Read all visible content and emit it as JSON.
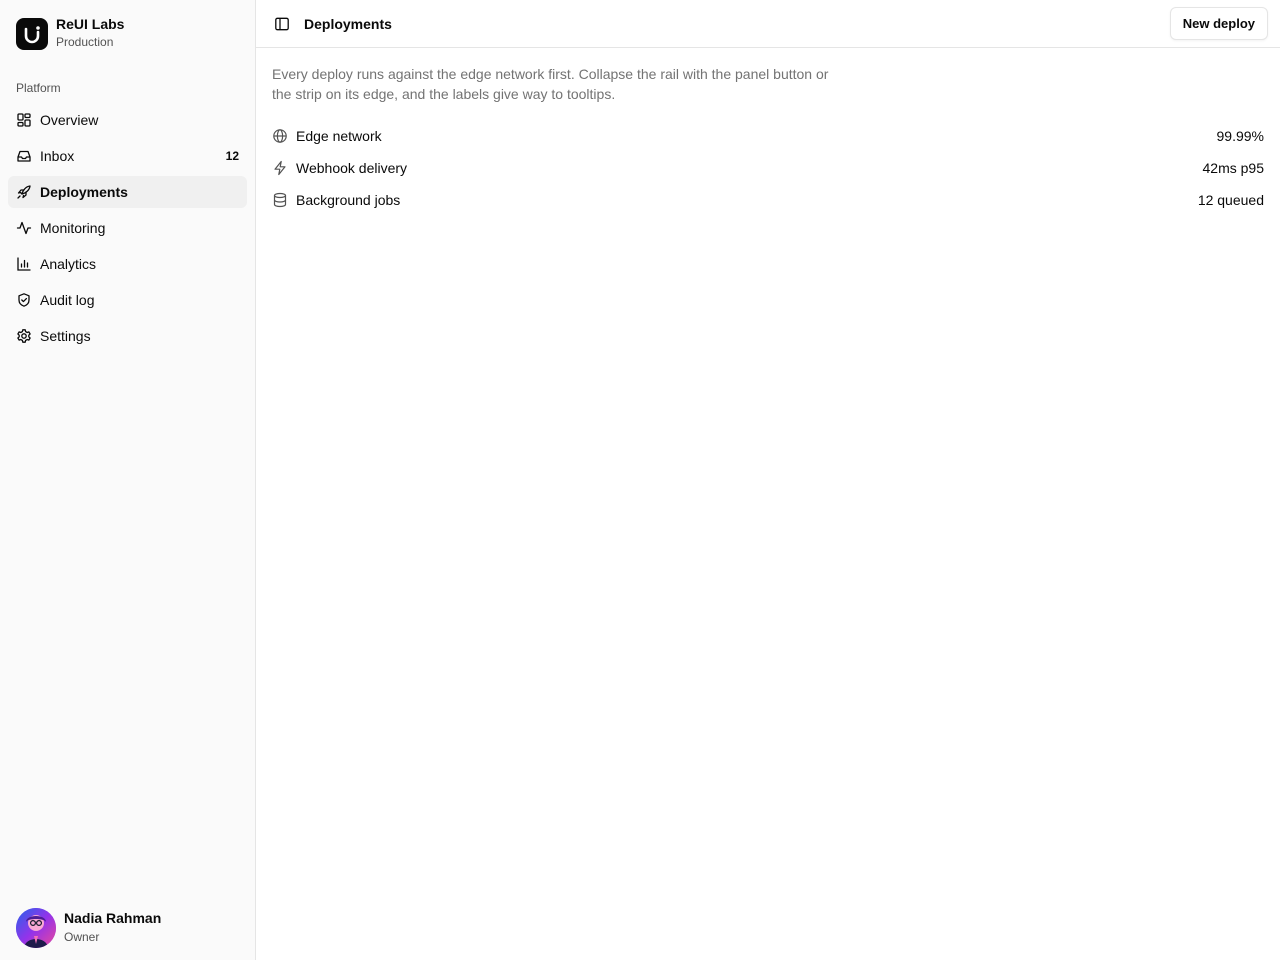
{
  "team": {
    "name": "ReUI Labs",
    "environment": "Production",
    "logo_icon": "reui-logo-icon"
  },
  "sidebar": {
    "group_label": "Platform",
    "items": [
      {
        "label": "Overview",
        "icon": "layout-grid-icon"
      },
      {
        "label": "Inbox",
        "icon": "inbox-icon",
        "badge": "12"
      },
      {
        "label": "Deployments",
        "icon": "rocket-icon",
        "active": true
      },
      {
        "label": "Monitoring",
        "icon": "activity-icon"
      },
      {
        "label": "Analytics",
        "icon": "bar-chart-icon"
      },
      {
        "label": "Audit log",
        "icon": "shield-check-icon"
      },
      {
        "label": "Settings",
        "icon": "gear-icon"
      }
    ]
  },
  "user": {
    "name": "Nadia Rahman",
    "role": "Owner"
  },
  "header": {
    "title": "Deployments",
    "toggle_icon": "panel-left-icon",
    "primary_button": "New deploy"
  },
  "main": {
    "description": "Every deploy runs against the edge network first. Collapse the rail with the panel button or the strip on its edge, and the labels give way to tooltips.",
    "stats": [
      {
        "label": "Edge network",
        "value": "99.99%",
        "icon": "globe-icon"
      },
      {
        "label": "Webhook delivery",
        "value": "42ms p95",
        "icon": "zap-icon"
      },
      {
        "label": "Background jobs",
        "value": "12 queued",
        "icon": "database-icon"
      }
    ]
  },
  "colors": {
    "accent": "#0a0a0a",
    "sidebar_bg": "#fafafa",
    "border": "#e5e5e5",
    "muted_text": "#737373",
    "active_item_bg": "#f0f0f0"
  }
}
